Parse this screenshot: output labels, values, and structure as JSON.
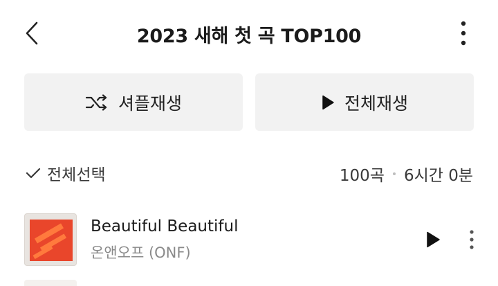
{
  "header": {
    "title": "2023 새해 첫 곡 TOP100",
    "back_icon": "chevron-left-icon",
    "more_icon": "more-vertical-icon"
  },
  "actions": {
    "shuffle_label": "셔플재생",
    "shuffle_icon": "shuffle-icon",
    "play_all_label": "전체재생",
    "play_all_icon": "play-icon"
  },
  "list_controls": {
    "select_all_label": "전체선택",
    "select_icon": "check-icon",
    "track_count": "100곡",
    "total_duration": "6시간 0분"
  },
  "tracks": [
    {
      "title": "Beautiful Beautiful",
      "artist": "온앤오프 (ONF)",
      "play_icon": "play-icon",
      "more_icon": "more-vertical-icon"
    }
  ],
  "colors": {
    "button_bg": "#f2f2f2",
    "text_primary": "#1b1b1b",
    "text_secondary": "#8a8a8a",
    "album_accent": "#e9462b"
  }
}
